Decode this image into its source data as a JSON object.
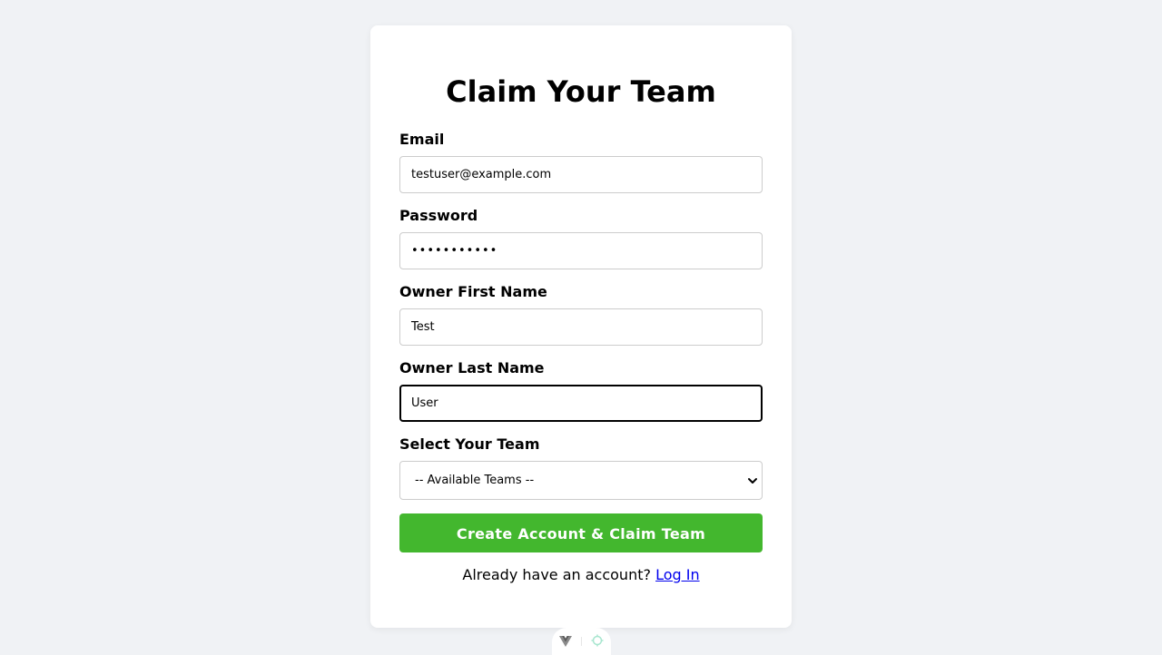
{
  "form": {
    "title": "Claim Your Team",
    "email": {
      "label": "Email",
      "value": "testuser@example.com"
    },
    "password": {
      "label": "Password",
      "value": "•••••••••••"
    },
    "first_name": {
      "label": "Owner First Name",
      "value": "Test"
    },
    "last_name": {
      "label": "Owner Last Name",
      "value": "User"
    },
    "team": {
      "label": "Select Your Team",
      "selected": "-- Available Teams --"
    },
    "submit_label": "Create Account & Claim Team",
    "login_prompt": "Already have an account?",
    "login_link": "Log In"
  },
  "devtools": {
    "icons": [
      "vue-logo-icon",
      "inspector-target-icon"
    ]
  },
  "colors": {
    "background": "#f0f2f5",
    "card": "#ffffff",
    "submit": "#43b72e",
    "link": "#0000ee",
    "focus_border": "#000000"
  }
}
